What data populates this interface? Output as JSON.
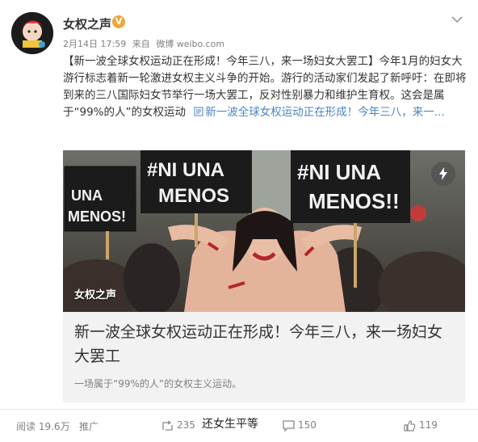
{
  "post": {
    "username": "女权之声",
    "verified_badge": "V",
    "date": "2月14日 17:59",
    "source_prefix": "来自",
    "source": "微博 weibo.com",
    "text": "【新一波全球女权运动正在形成！今年三八，来一场妇女大罢工】今年1月的妇女大游行标志着新一轮激进女权主义斗争的开始。游行的活动家们发起了新呼吁：在即将到来的三八国际妇女节举行一场大罢工，反对性别暴力和维护生育权。这会是属于“99%的人”的女权运动",
    "link_text": "新一波全球女权运动正在形成！今年三八，来一..."
  },
  "card": {
    "photo_label": "女权之声",
    "signs": [
      "#NI UNA MENOS!",
      "UNA MENOS!",
      "#NI UNA MENOS!!"
    ],
    "title": "新一波全球女权运动正在形成！今年三八，来一场妇女大罢工",
    "description": "一场属于“99%的人”的女权主义运动。"
  },
  "footer": {
    "reads_label": "阅读",
    "reads_value": "19.6万",
    "promote_label": "推广",
    "repost_count": "235",
    "comment_count": "150",
    "like_count": "119"
  },
  "watermark": "还女生平等",
  "colors": {
    "link": "#4a84c6",
    "badge": "#f0a63a"
  }
}
